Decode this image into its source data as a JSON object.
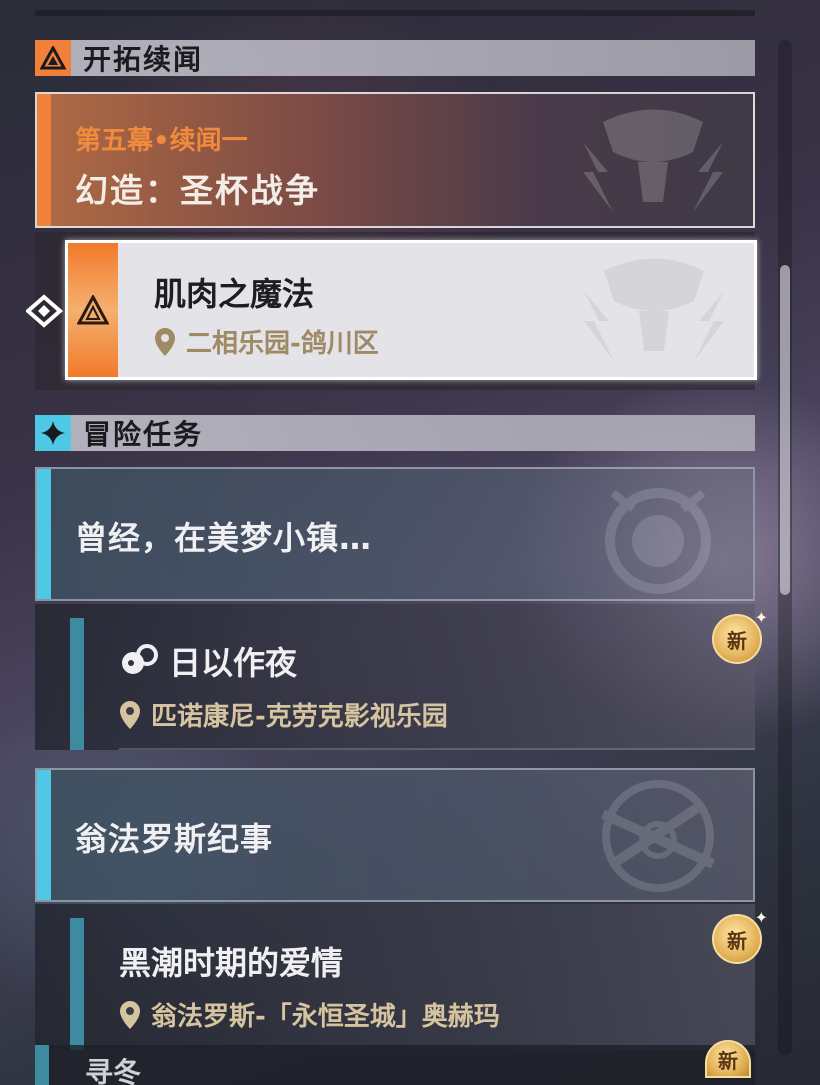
{
  "sections": {
    "trailblaze": {
      "title": "开拓续闻"
    },
    "adventure": {
      "title": "冒险任务"
    }
  },
  "chapter": {
    "subtitle": "第五幕•续闻一",
    "title": "幻造：圣杯战争"
  },
  "selected_quest": {
    "name": "肌肉之魔法",
    "location": "二相乐园-鸽川区"
  },
  "categories": [
    {
      "label": "曾经，在美梦小镇…"
    },
    {
      "label": "翁法罗斯纪事"
    }
  ],
  "quests": [
    {
      "name": "日以作夜",
      "location": "匹诺康尼-克劳克影视乐园",
      "badge": "新"
    },
    {
      "name": "黑潮时期的爱情",
      "location": "翁法罗斯-「永恒圣城」奥赫玛",
      "badge": "新"
    }
  ],
  "partial_item": {
    "text": "寻冬",
    "badge": "新"
  },
  "colors": {
    "trailblaze_accent": "#f0803a",
    "adventure_accent": "#4fc8e6",
    "location_text": "#d6c4a0"
  },
  "icons": {
    "trailblaze_section": "triangle-emblem-icon",
    "adventure_section": "four-point-star-icon",
    "location": "map-pin-icon",
    "companion": "companion-quest-icon",
    "selected": "selection-arrow-icon"
  }
}
